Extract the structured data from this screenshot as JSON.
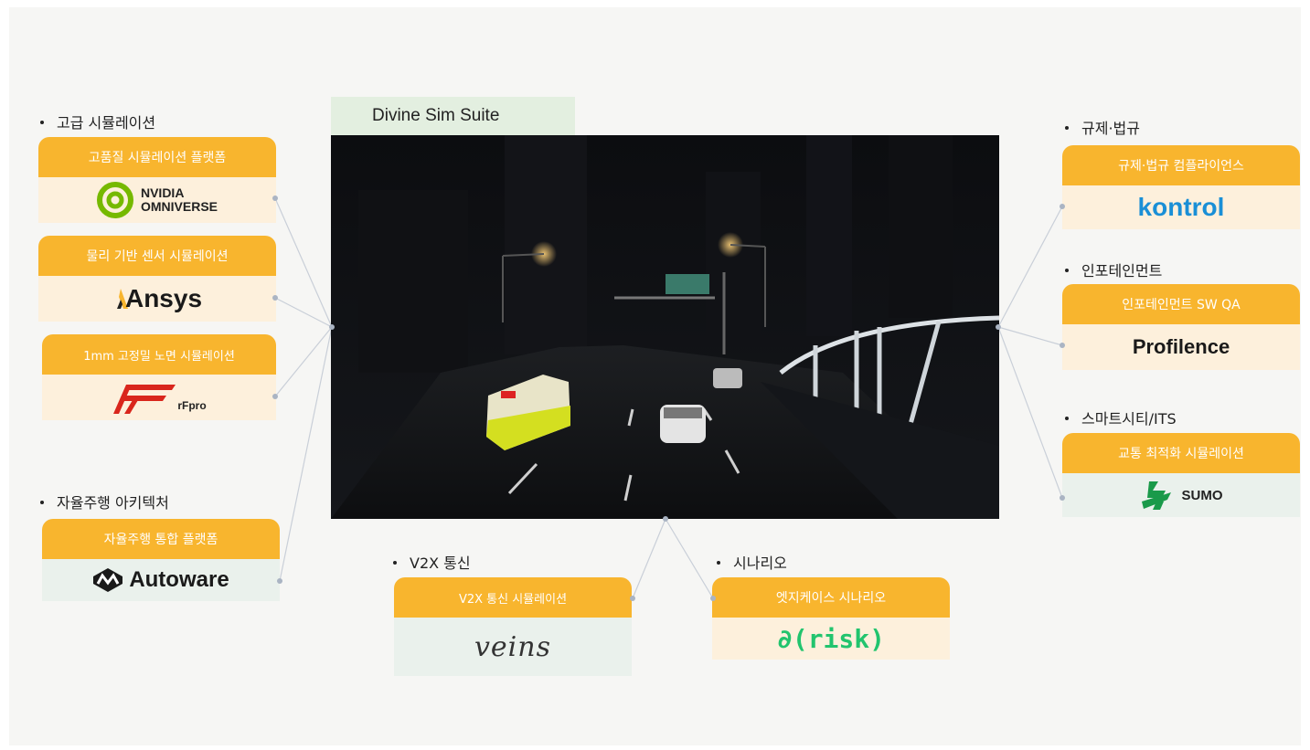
{
  "center": {
    "title": "Divine Sim Suite"
  },
  "sections": {
    "advanced_sim": {
      "title": "고급 시뮬레이션",
      "cards": [
        {
          "label": "고품질 시뮬레이션 플랫폼",
          "logo_text": [
            "NVIDIA",
            "OMNIVERSE"
          ],
          "logo_icon": "omniverse-icon"
        },
        {
          "label": "물리 기반 센서 시뮬레이션",
          "logo_text": "Ansys",
          "logo_icon": "ansys-icon"
        },
        {
          "label": "1mm 고정밀 노면 시뮬레이션",
          "logo_text": "rFpro",
          "logo_icon": "rfpro-icon"
        }
      ]
    },
    "autonomy": {
      "title": "자율주행 아키텍처",
      "cards": [
        {
          "label": "자율주행 통합 플랫폼",
          "logo_text": "Autoware",
          "logo_icon": "autoware-icon"
        }
      ]
    },
    "v2x": {
      "title": "V2X 통신",
      "cards": [
        {
          "label": "V2X 통신 시뮬레이션",
          "logo_text": "veins",
          "logo_icon": "veins-icon"
        }
      ]
    },
    "scenario": {
      "title": "시나리오",
      "cards": [
        {
          "label": "엣지케이스 시나리오",
          "logo_text": "∂(risk)",
          "logo_icon": "drisk-icon"
        }
      ]
    },
    "regulation": {
      "title": "규제·법규",
      "cards": [
        {
          "label": "규제·법규 컴플라이언스",
          "logo_text": "kontrol",
          "logo_icon": "kontrol-icon"
        }
      ]
    },
    "infotainment": {
      "title": "인포테인먼트",
      "cards": [
        {
          "label": "인포테인먼트 SW QA",
          "logo_text": "Profilence",
          "logo_icon": "profilence-icon"
        }
      ]
    },
    "smartcity": {
      "title": "스마트시티/ITS",
      "cards": [
        {
          "label": "교통 최적화 시뮬레이션",
          "logo_text": "SUMO",
          "logo_icon": "sumo-icon"
        }
      ]
    }
  },
  "colors": {
    "accent": "#f8b52e",
    "peach": "#fdf0dc",
    "mint": "#eaf1ec",
    "tab": "#e3efe0",
    "kontrol": "#1a8fd6",
    "drisk": "#22c46e",
    "rfpro": "#d9261c",
    "omniverse": "#76b900"
  }
}
